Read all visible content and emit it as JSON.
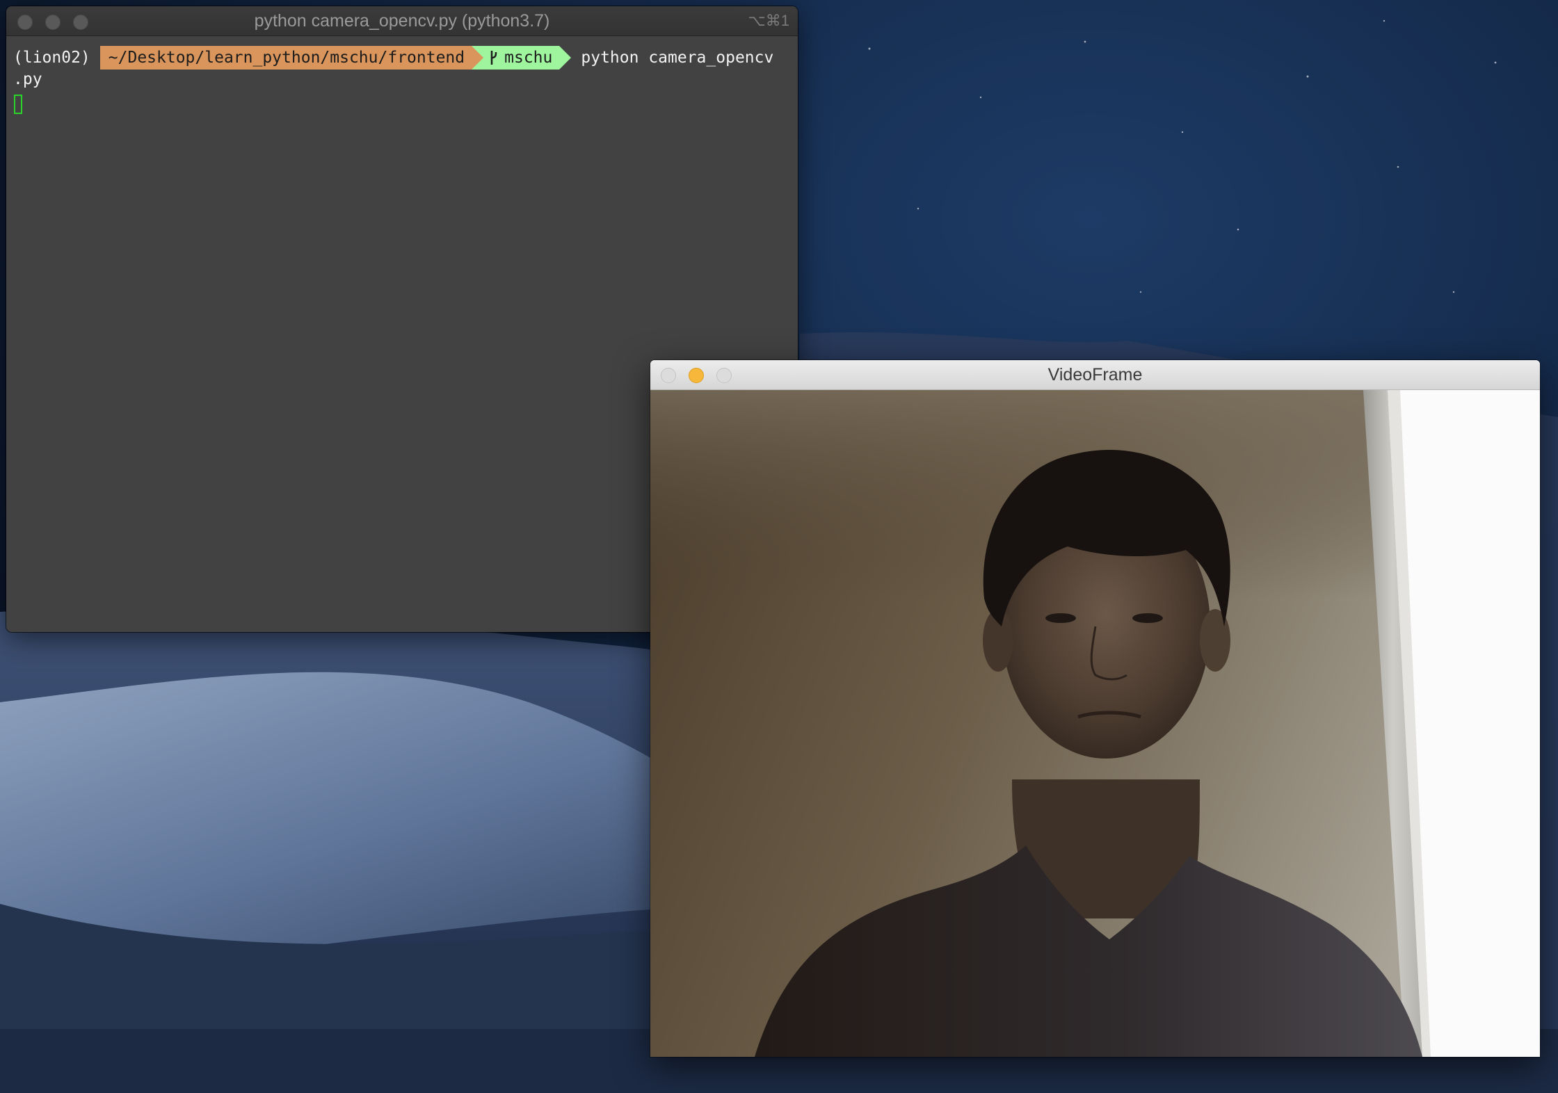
{
  "terminal": {
    "title": "python camera_opencv.py (python3.7)",
    "shortcut": "⌥⌘1",
    "prompt": {
      "env": "(lion02)",
      "path": "~/Desktop/learn_python/mschu/frontend",
      "git_branch": "mschu",
      "git_icon": "git-branch-icon",
      "command": "python camera_opencv",
      "command_wrap": ".py"
    },
    "colors": {
      "background": "#424242",
      "path_segment": "#d9955b",
      "git_segment": "#9ff59e",
      "cursor": "#29d32a"
    }
  },
  "video_window": {
    "title": "VideoFrame",
    "minimize_color": "#f6b73a"
  }
}
